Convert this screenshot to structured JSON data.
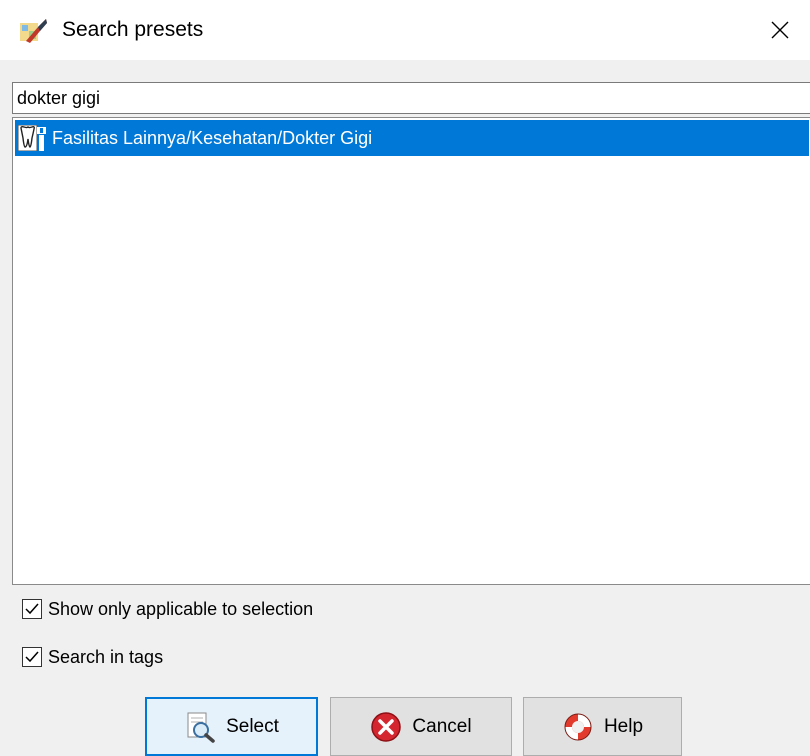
{
  "window": {
    "title": "Search presets",
    "close_glyph": "✕"
  },
  "search": {
    "value": "dokter gigi"
  },
  "results": [
    {
      "label": "Fasilitas Lainnya/Kesehatan/Dokter Gigi",
      "icon": "tooth-icon",
      "selected": true
    }
  ],
  "options": {
    "applicable_label": "Show only applicable to selection",
    "applicable_checked": true,
    "tags_label": "Search in tags",
    "tags_checked": true
  },
  "buttons": {
    "select_label": "Select",
    "cancel_label": "Cancel",
    "help_label": "Help"
  },
  "colors": {
    "selection": "#0078d7",
    "cancel_icon": "#d4262f",
    "help_icon": "#e23b2d"
  }
}
